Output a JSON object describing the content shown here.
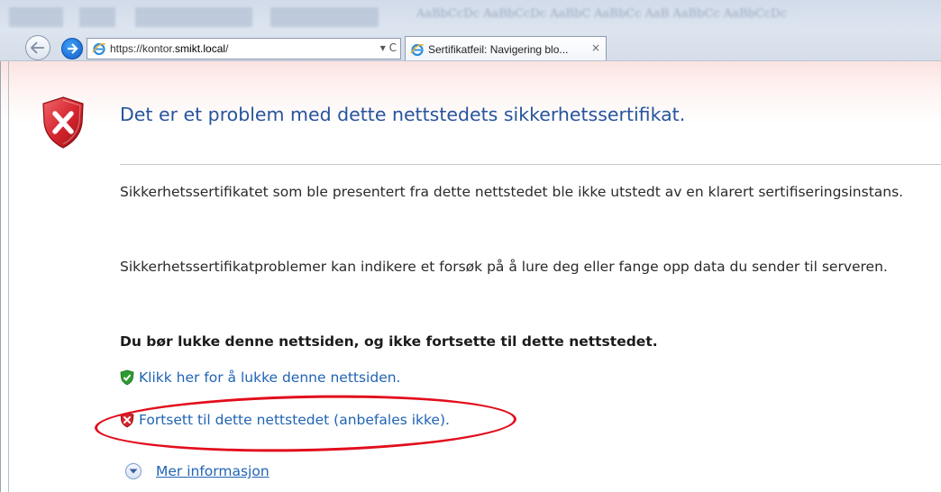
{
  "browser": {
    "address_url_prefix": "https://kontor.",
    "address_url_domain": "smikt.local",
    "address_url_suffix": "/",
    "address_controls": "▾ C",
    "tab_title": "Sertifikatfeil: Navigering blo...",
    "tab_close": "×",
    "ribbon_ghost_text": "AaBbCcDc AaBbCcDc AaBbC AaBbCc AaB AaBbCc AaBbCcDc"
  },
  "page": {
    "title": "Det er et problem med dette nettstedets sikkerhetssertifikat.",
    "paragraph1": "Sikkerhetssertifikatet som ble presentert fra dette nettstedet ble ikke utstedt av en klarert sertifiseringsinstans.",
    "paragraph2": "Sikkerhetssertifikatproblemer kan indikere et forsøk på å lure deg eller fange opp data du sender til serveren.",
    "warning": "Du bør lukke denne nettsiden, og ikke fortsette til dette nettstedet.",
    "close_link": "Klikk her for å lukke denne nettsiden.",
    "continue_link": "Fortsett til dette nettstedet (anbefales ikke).",
    "more_info_link": "Mer informasjon"
  },
  "colors": {
    "title_blue": "#27549c",
    "link_blue": "#2164b4",
    "annotation_red": "#e20d1c",
    "shield_red": "#d3242c",
    "shield_green": "#2e9a32"
  },
  "icons": [
    "error-shield-icon",
    "back-arrow-icon",
    "forward-arrow-icon",
    "ie-logo-icon",
    "green-shield-icon",
    "red-shield-icon",
    "chevron-down-icon"
  ]
}
